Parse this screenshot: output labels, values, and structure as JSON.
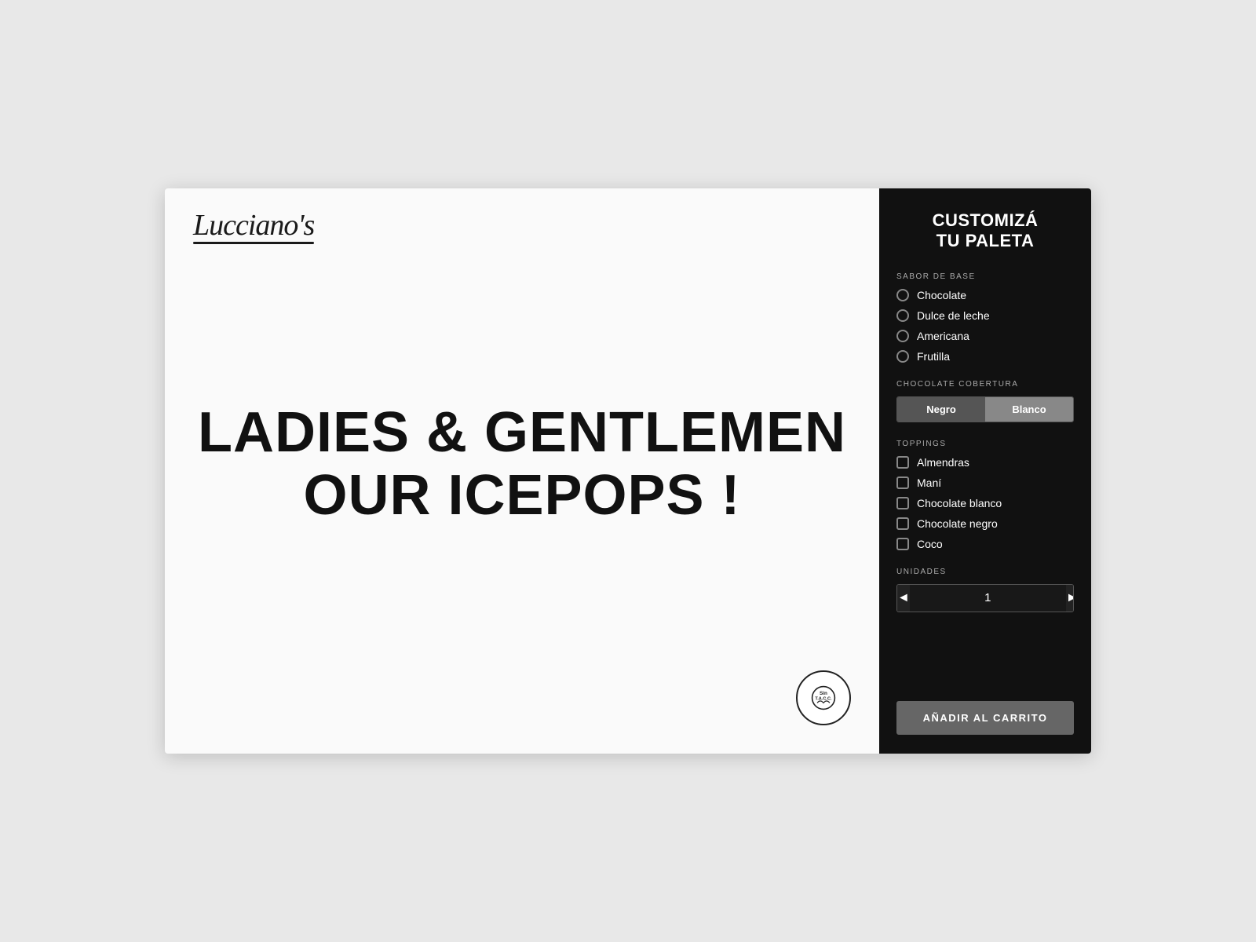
{
  "app": {
    "title": "Lucciano's Icepops"
  },
  "logo": {
    "text": "Lucciano's"
  },
  "hero": {
    "line1": "LADIES & GENTLEMEN",
    "line2": "OUR  ICEPOPS !"
  },
  "badge": {
    "line1": "Sin T.A.C.C.",
    "icon": "🌾"
  },
  "sidebar": {
    "title_line1": "CUSTOMIZÁ",
    "title_line2": "TU PALETA",
    "sabor_label": "SABOR DE BASE",
    "sabor_options": [
      {
        "id": "chocolate",
        "label": "Chocolate"
      },
      {
        "id": "dulce-leche",
        "label": "Dulce de leche"
      },
      {
        "id": "americana",
        "label": "Americana"
      },
      {
        "id": "frutilla",
        "label": "Frutilla"
      }
    ],
    "cobertura_label": "CHOCOLATE COBERTURA",
    "cobertura_options": [
      {
        "id": "negro",
        "label": "Negro",
        "active": true
      },
      {
        "id": "blanco",
        "label": "Blanco",
        "active": false
      }
    ],
    "toppings_label": "TOPPINGS",
    "toppings_options": [
      {
        "id": "almendras",
        "label": "Almendras"
      },
      {
        "id": "mani",
        "label": "Maní"
      },
      {
        "id": "choc-blanco",
        "label": "Chocolate blanco"
      },
      {
        "id": "choc-negro",
        "label": "Chocolate negro"
      },
      {
        "id": "coco",
        "label": "Coco"
      }
    ],
    "unidades_label": "UNIDADES",
    "unidades_value": "1",
    "decrement_label": "◄",
    "increment_label": "►",
    "add_to_cart_label": "AÑADIR AL CARRITO"
  }
}
